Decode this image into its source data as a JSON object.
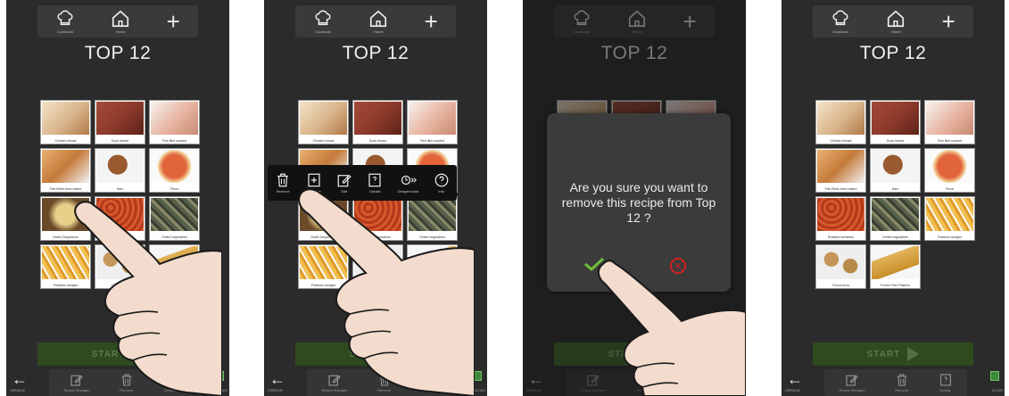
{
  "header": {
    "title": "TOP 12",
    "nav_cookbook": "Cookbook",
    "nav_home": "Home",
    "nav_add": "+"
  },
  "recipes_full": [
    {
      "label": "Chicken breast",
      "color": "#d8b48a"
    },
    {
      "label": "Duck breast",
      "color": "#8e3b2c"
    },
    {
      "label": "Fish fillet roasted",
      "color": "#e7b3a0"
    },
    {
      "label": "Fish fillets fresh baked",
      "color": "#c57a3a"
    },
    {
      "label": "Ham",
      "color": "#9a5a30"
    },
    {
      "label": "Pizza",
      "color": "#d9532a"
    },
    {
      "label": "Gratin Dauphinois",
      "color": "#d8c180"
    },
    {
      "label": "Roasted tomatoes",
      "color": "#cc4a26"
    },
    {
      "label": "Grilled vegetables",
      "color": "#56604a"
    },
    {
      "label": "Potatoes wedges",
      "color": "#e8a83a"
    },
    {
      "label": "Choux buns",
      "color": "#b88a4a"
    },
    {
      "label": "Frozen Flan Pastries",
      "color": "#e2b35a"
    }
  ],
  "recipes_after": [
    {
      "label": "Chicken breast",
      "color": "#d8b48a"
    },
    {
      "label": "Duck breast",
      "color": "#8e3b2c"
    },
    {
      "label": "Fish fillet roasted",
      "color": "#e7b3a0"
    },
    {
      "label": "Fish fillets fresh baked",
      "color": "#c57a3a"
    },
    {
      "label": "Ham",
      "color": "#9a5a30"
    },
    {
      "label": "Pizza",
      "color": "#d9532a"
    },
    {
      "label": "Roasted tomatoes",
      "color": "#cc4a26"
    },
    {
      "label": "Grilled vegetables",
      "color": "#56604a"
    },
    {
      "label": "Potatoes wedges",
      "color": "#e8a83a"
    },
    {
      "label": "Choux buns",
      "color": "#b88a4a"
    },
    {
      "label": "Frozen Flan Pastries",
      "color": "#e2b35a"
    }
  ],
  "context_menu": {
    "remove": "Remove",
    "duplicate": "Duplicate",
    "edit": "Edit",
    "details": "Details",
    "delayed_start": "Delayed start",
    "info": "Info"
  },
  "dialog": {
    "message": "Are you sure you want to remove this recipe from Top 12 ?"
  },
  "footer": {
    "start": "START",
    "back_label": "GERDIUM",
    "recipe_manager": "Recipe Manager",
    "remove": "Remove",
    "details": "Details",
    "cloud_label": "CLOUD"
  },
  "colors": {
    "start_bar": "#2e4a1e",
    "confirm": "#6fbf3a",
    "cancel": "#d32020",
    "hand": "#f3dccd"
  }
}
